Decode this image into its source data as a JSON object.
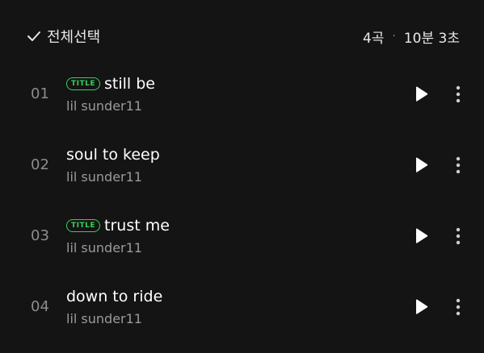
{
  "header": {
    "select_all_label": "전체선택",
    "check_icon": "check-icon",
    "track_count": "4곡",
    "separator": "·",
    "total_duration": "10분 3초"
  },
  "badge_color": "#35d158",
  "tracks": [
    {
      "number": "01",
      "badge": "TITLE",
      "title": "still be",
      "artist": "lil sunder11"
    },
    {
      "number": "02",
      "badge": "",
      "title": "soul to keep",
      "artist": "lil sunder11"
    },
    {
      "number": "03",
      "badge": "TITLE",
      "title": "trust me",
      "artist": "lil sunder11"
    },
    {
      "number": "04",
      "badge": "",
      "title": "down to ride",
      "artist": "lil sunder11"
    }
  ],
  "icons": {
    "play": "play-icon",
    "more": "more-vertical-icon"
  }
}
